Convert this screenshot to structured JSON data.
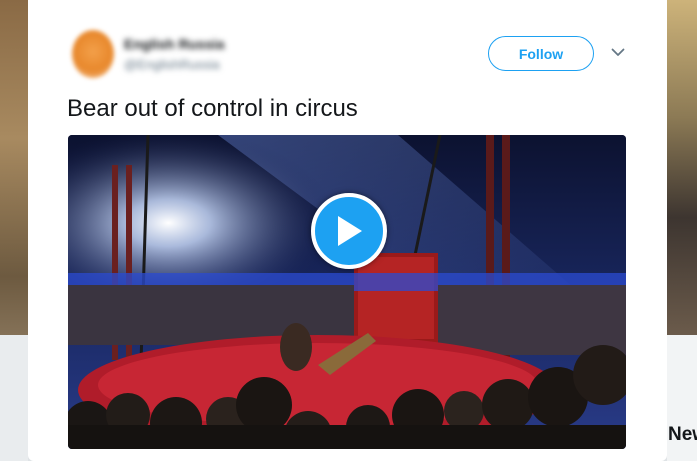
{
  "tweet": {
    "author_name": "English Russia",
    "author_handle": "@EnglishRussia",
    "follow_label": "Follow",
    "text": "Bear out of control in circus",
    "menu_icon": "chevron-down-icon",
    "video_play_icon": "play-icon"
  },
  "background": {
    "right_partial_text": "New"
  },
  "colors": {
    "accent": "#1da1f2",
    "text": "#14171a",
    "secondary_text": "#657786"
  }
}
